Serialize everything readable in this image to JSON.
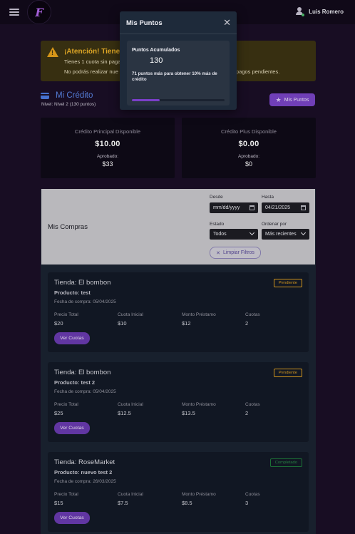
{
  "header": {
    "logo_text": "F",
    "user_name": "Luis Romero"
  },
  "alert": {
    "title": "¡Atención! Tienes",
    "line1": "Tienes 1 cuota sin paga",
    "line2": "No podrás realizar nue",
    "line2_tail": "pagos pendientes."
  },
  "credit": {
    "title": "Mi Crédito",
    "level": "Nivel: Nivel 2 (130 puntos)",
    "points_button": "Mis Puntos",
    "principal": {
      "label": "Crédito Principal Disponible",
      "amount": "$10.00",
      "approved_label": "Aprobado:",
      "approved_value": "$33"
    },
    "plus": {
      "label": "Crédito Plus Disponible",
      "amount": "$0.00",
      "approved_label": "Aprobado:",
      "approved_value": "$0"
    }
  },
  "purchases": {
    "title": "Mis Compras",
    "filters": {
      "from_label": "Desde",
      "from_value": "mm/dd/yyyy",
      "to_label": "Hasta",
      "to_value": "04/21/2025",
      "status_label": "Estado",
      "status_value": "Todos",
      "sort_label": "Ordenar por",
      "sort_value": "Más recientes",
      "clear_button": "Limpiar Filtros"
    },
    "columns": {
      "price": "Precio Total",
      "initial": "Cuota Inicial",
      "loan": "Monto Préstamo",
      "installments": "Cuotas"
    },
    "view_button": "Ver Cuotas",
    "orders": [
      {
        "store": "Tienda: El bombon",
        "product": "Producto: test",
        "date": "Fecha de compra: 05/04/2025",
        "status": "Pendiente",
        "price": "$20",
        "initial": "$10",
        "loan": "$12",
        "installments": "2"
      },
      {
        "store": "Tienda: El bombon",
        "product": "Producto: test 2",
        "date": "Fecha de compra: 05/04/2025",
        "status": "Pendiente",
        "price": "$25",
        "initial": "$12.5",
        "loan": "$13.5",
        "installments": "2"
      },
      {
        "store": "Tienda: RoseMarket",
        "product": "Producto: nuevo test 2",
        "date": "Fecha de compra: 26/03/2025",
        "status": "Completado",
        "price": "$15",
        "initial": "$7.5",
        "loan": "$8.5",
        "installments": "3"
      }
    ]
  },
  "modal": {
    "title": "Mis Puntos",
    "points_label": "Puntos Acumulados",
    "points_value": "130",
    "message": "71 puntos más para obtener 10% más de crédito",
    "progress_fraction": 0.3
  },
  "colors": {
    "accent": "#7a45c7",
    "pending": "#e0a020",
    "completed": "#1f7a3a",
    "alert": "#f0b429",
    "link": "#5b86e8"
  }
}
